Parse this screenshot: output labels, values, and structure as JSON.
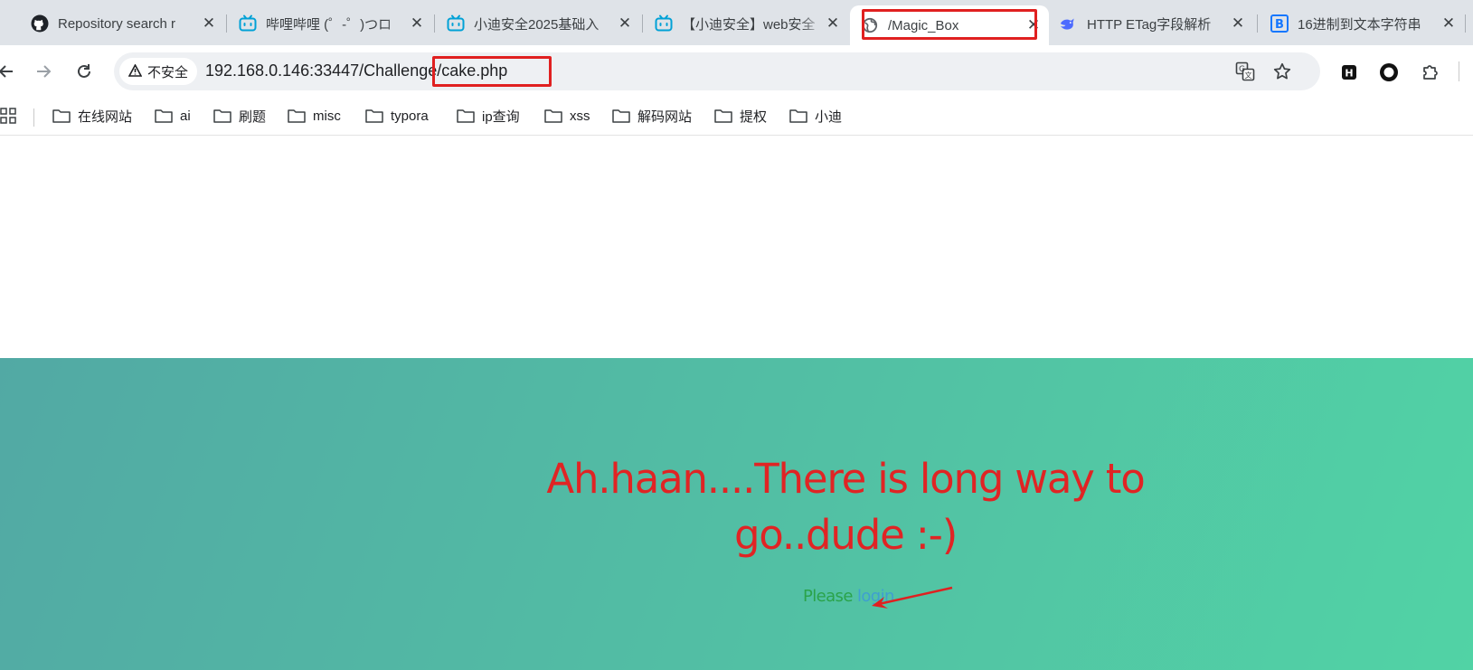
{
  "browser": {
    "tabs": [
      {
        "title": "Repository search r",
        "favicon": "github-icon"
      },
      {
        "title": "哔哩哔哩 (゜-゜)つロ",
        "favicon": "bilibili-icon"
      },
      {
        "title": "小迪安全2025基础入",
        "favicon": "bilibili-icon"
      },
      {
        "title": "【小迪安全】web安全",
        "favicon": "bilibili-icon"
      },
      {
        "title": "/Magic_Box",
        "favicon": "globe-icon",
        "active": true
      },
      {
        "title": "HTTP ETag字段解析",
        "favicon": "deepseek-icon"
      },
      {
        "title": "16进制到文本字符串",
        "favicon": "b-letter-icon"
      }
    ],
    "tab_close_glyph": "✕",
    "address_bar": {
      "security_label": "不安全",
      "url_base": "192.168.0.146:33447/Challeng",
      "url_tail": "e/cake.php"
    },
    "bookmarks": [
      {
        "label": "在线网站"
      },
      {
        "label": "ai"
      },
      {
        "label": "刷题"
      },
      {
        "label": "misc"
      },
      {
        "label": "typora"
      },
      {
        "label": "ip查询"
      },
      {
        "label": "xss"
      },
      {
        "label": "解码网站"
      },
      {
        "label": "提权"
      },
      {
        "label": "小迪"
      }
    ],
    "extensions": [
      "h-letter-extension-icon",
      "circle-extension-icon",
      "puzzle-extensions-icon"
    ]
  },
  "page": {
    "headline": "Ah.haan....There is long way to go..dude :-)",
    "please_text": "Please ",
    "link_text": "login"
  },
  "colors": {
    "annotation_red": "#e02020",
    "headline_red": "#e02424",
    "please_green": "#2aa34a",
    "link_blue": "#3f9fd0",
    "hero_gradient_start": "#52a9a4",
    "hero_gradient_end": "#51d3a5"
  }
}
